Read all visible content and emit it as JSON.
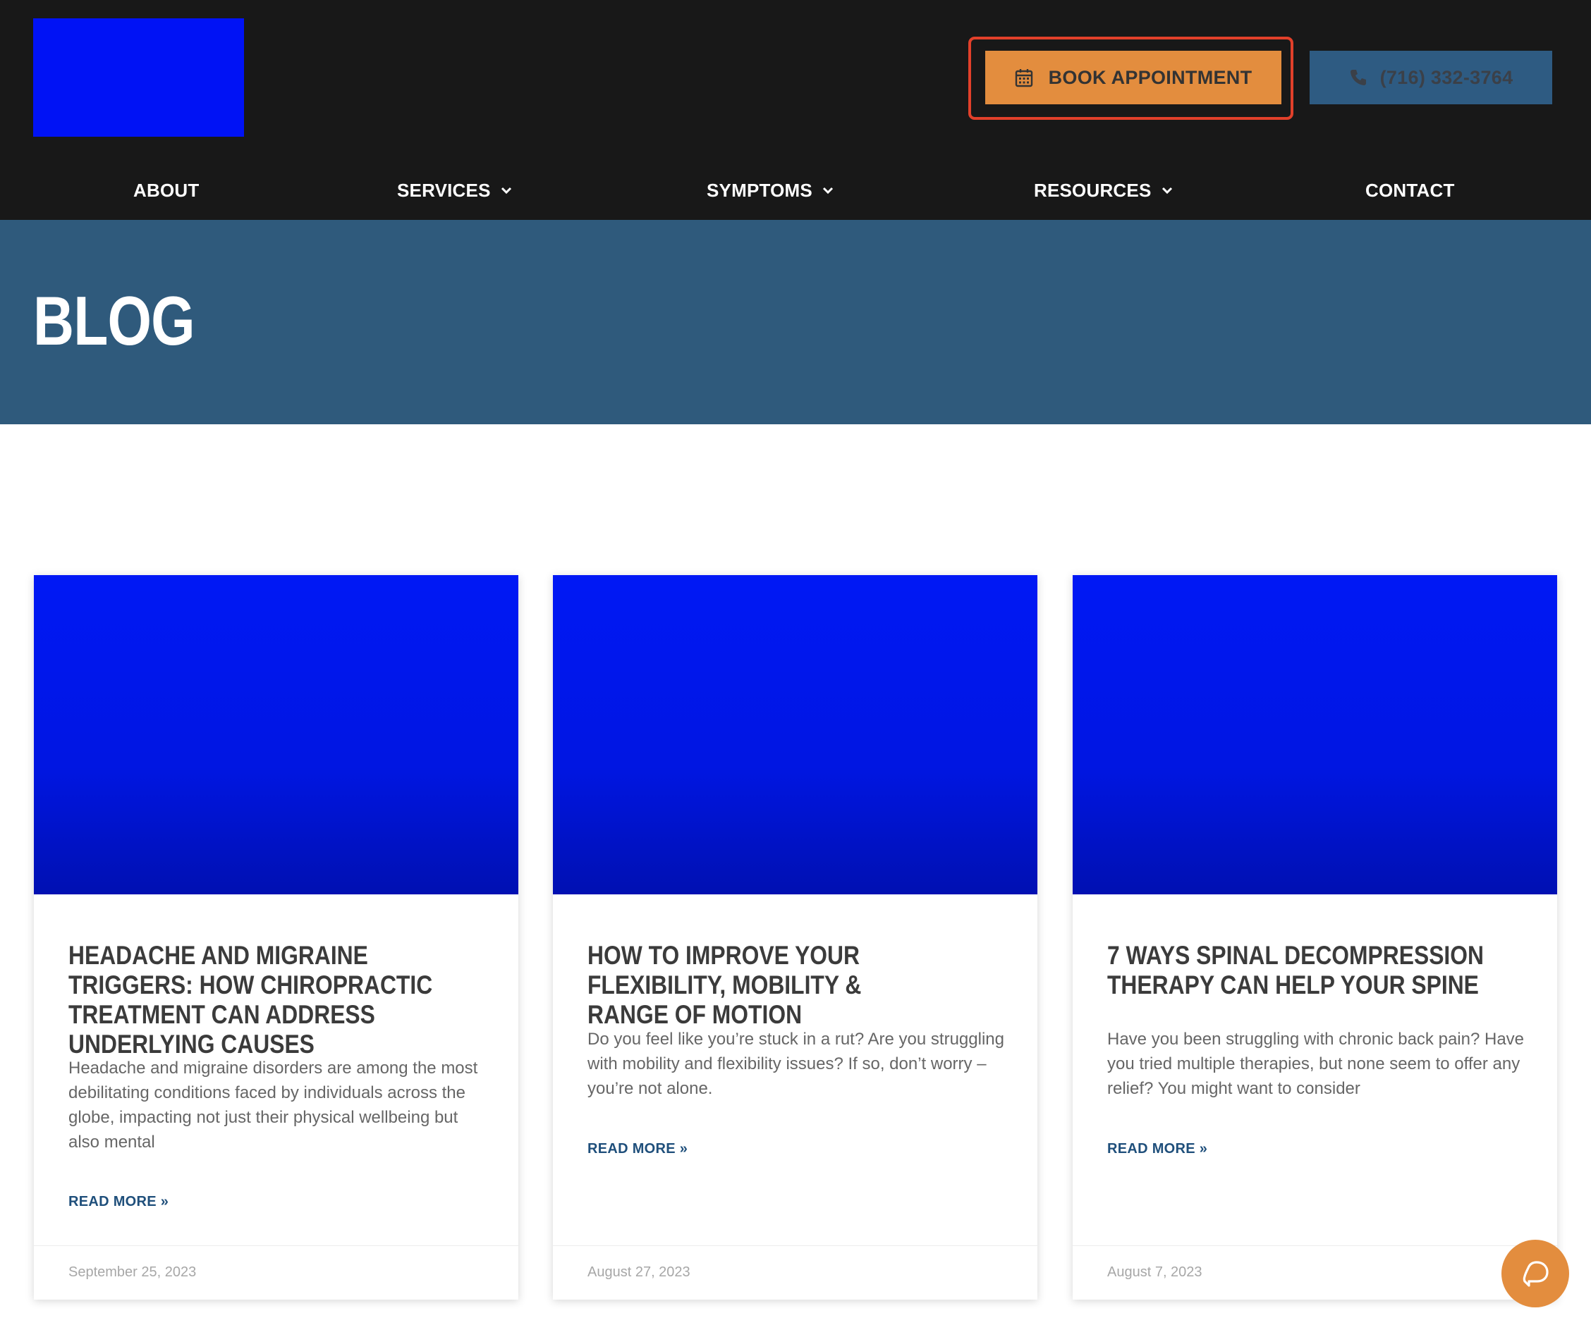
{
  "header": {
    "book_button": {
      "label": "BOOK APPOINTMENT",
      "icon": "calendar-icon"
    },
    "phone_button": {
      "label": "(716) 332-3764",
      "icon": "phone-icon"
    },
    "nav": [
      {
        "label": "ABOUT",
        "has_dropdown": false
      },
      {
        "label": "SERVICES",
        "has_dropdown": true
      },
      {
        "label": "SYMPTOMS",
        "has_dropdown": true
      },
      {
        "label": "RESOURCES",
        "has_dropdown": true
      },
      {
        "label": "CONTACT",
        "has_dropdown": false
      }
    ]
  },
  "hero": {
    "title": "BLOG"
  },
  "posts": [
    {
      "title": "HEADACHE AND MIGRAINE TRIGGERS: HOW CHIROPRACTIC TREATMENT CAN ADDRESS UNDERLYING CAUSES",
      "excerpt": "Headache and migraine disorders are among the most debilitating conditions faced by individuals across the globe, impacting not just their physical wellbeing but also mental",
      "read_more": "READ MORE »",
      "date": "September 25, 2023"
    },
    {
      "title": "HOW TO IMPROVE YOUR FLEXIBILITY, MOBILITY & RANGE OF MOTION",
      "excerpt": "Do you feel like you’re stuck in a rut? Are you struggling with mobility and flexibility issues? If so, don’t worry – you’re not alone.",
      "read_more": "READ MORE »",
      "date": "August 27, 2023"
    },
    {
      "title": "7 WAYS SPINAL DECOMPRESSION THERAPY CAN HELP YOUR SPINE",
      "excerpt": "Have you been struggling with chronic back pain? Have you tried multiple therapies, but none seem to offer any relief? You might want to consider",
      "read_more": "READ MORE »",
      "date": "August 7, 2023"
    }
  ],
  "chat": {
    "icon": "chat-bubble-icon"
  },
  "colors": {
    "header_bg": "#181818",
    "hero_bg": "#2f5a7c",
    "accent_orange": "#e38d3e",
    "phone_blue": "#2e5b82",
    "highlight_red": "#e2402a",
    "placeholder_blue": "#0018f5",
    "link_blue": "#1f4f7b"
  }
}
